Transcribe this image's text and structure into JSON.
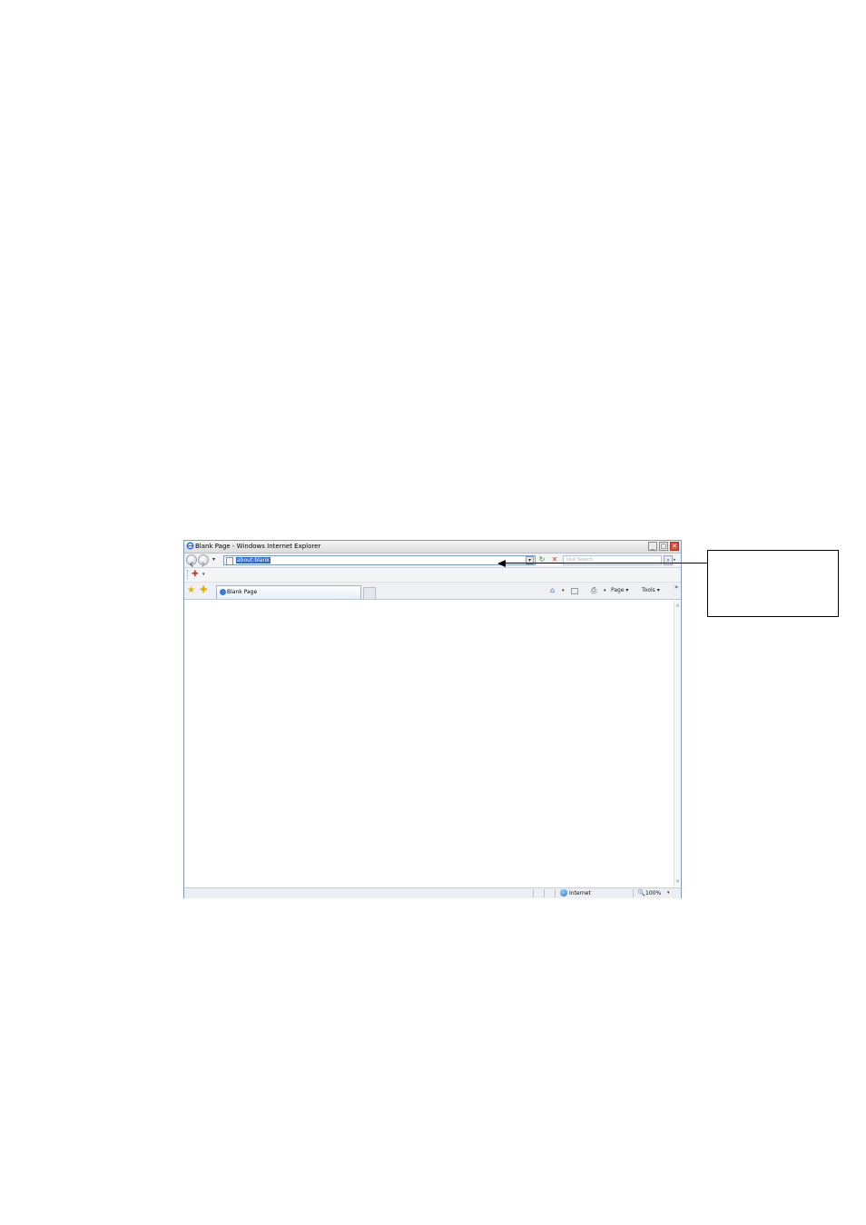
{
  "window": {
    "title": "Blank Page - Windows Internet Explorer",
    "min_glyph": "_",
    "max_glyph": "□",
    "close_glyph": "✕"
  },
  "address": {
    "url": "about:blank",
    "dropdown_glyph": "▾",
    "nav_dropdown_glyph": "▾",
    "refresh_glyph": "↻",
    "stop_glyph": "✕"
  },
  "search": {
    "placeholder": "Live Search",
    "button_glyph": "⌕",
    "dropdown_glyph": "▸"
  },
  "toolbar": {
    "addon_glyph": "✚",
    "addon_dropdown_glyph": "▾"
  },
  "tabs": {
    "favorites_glyph": "★",
    "add_favorites_glyph": "✚",
    "items": [
      {
        "label": "Blank Page"
      }
    ]
  },
  "commands": {
    "home_glyph": "⌂",
    "home_dropdown_glyph": "▾",
    "print_glyph": "⎙",
    "print_dropdown_glyph": "▾",
    "page_label": "Page ▾",
    "tools_label": "Tools ▾",
    "more_glyph": "»"
  },
  "statusbar": {
    "zone_label": "Internet",
    "zoom_glyph": "🔍",
    "zoom_label": "100%",
    "zoom_dropdown_glyph": "▾"
  },
  "scrollbar": {
    "up_glyph": "▲",
    "down_glyph": "▼"
  },
  "icons": {
    "app": "ie-logo-icon",
    "back": "back-arrow-icon",
    "forward": "forward-arrow-icon",
    "page": "page-icon",
    "search": "search-icon",
    "globe": "globe-icon"
  }
}
